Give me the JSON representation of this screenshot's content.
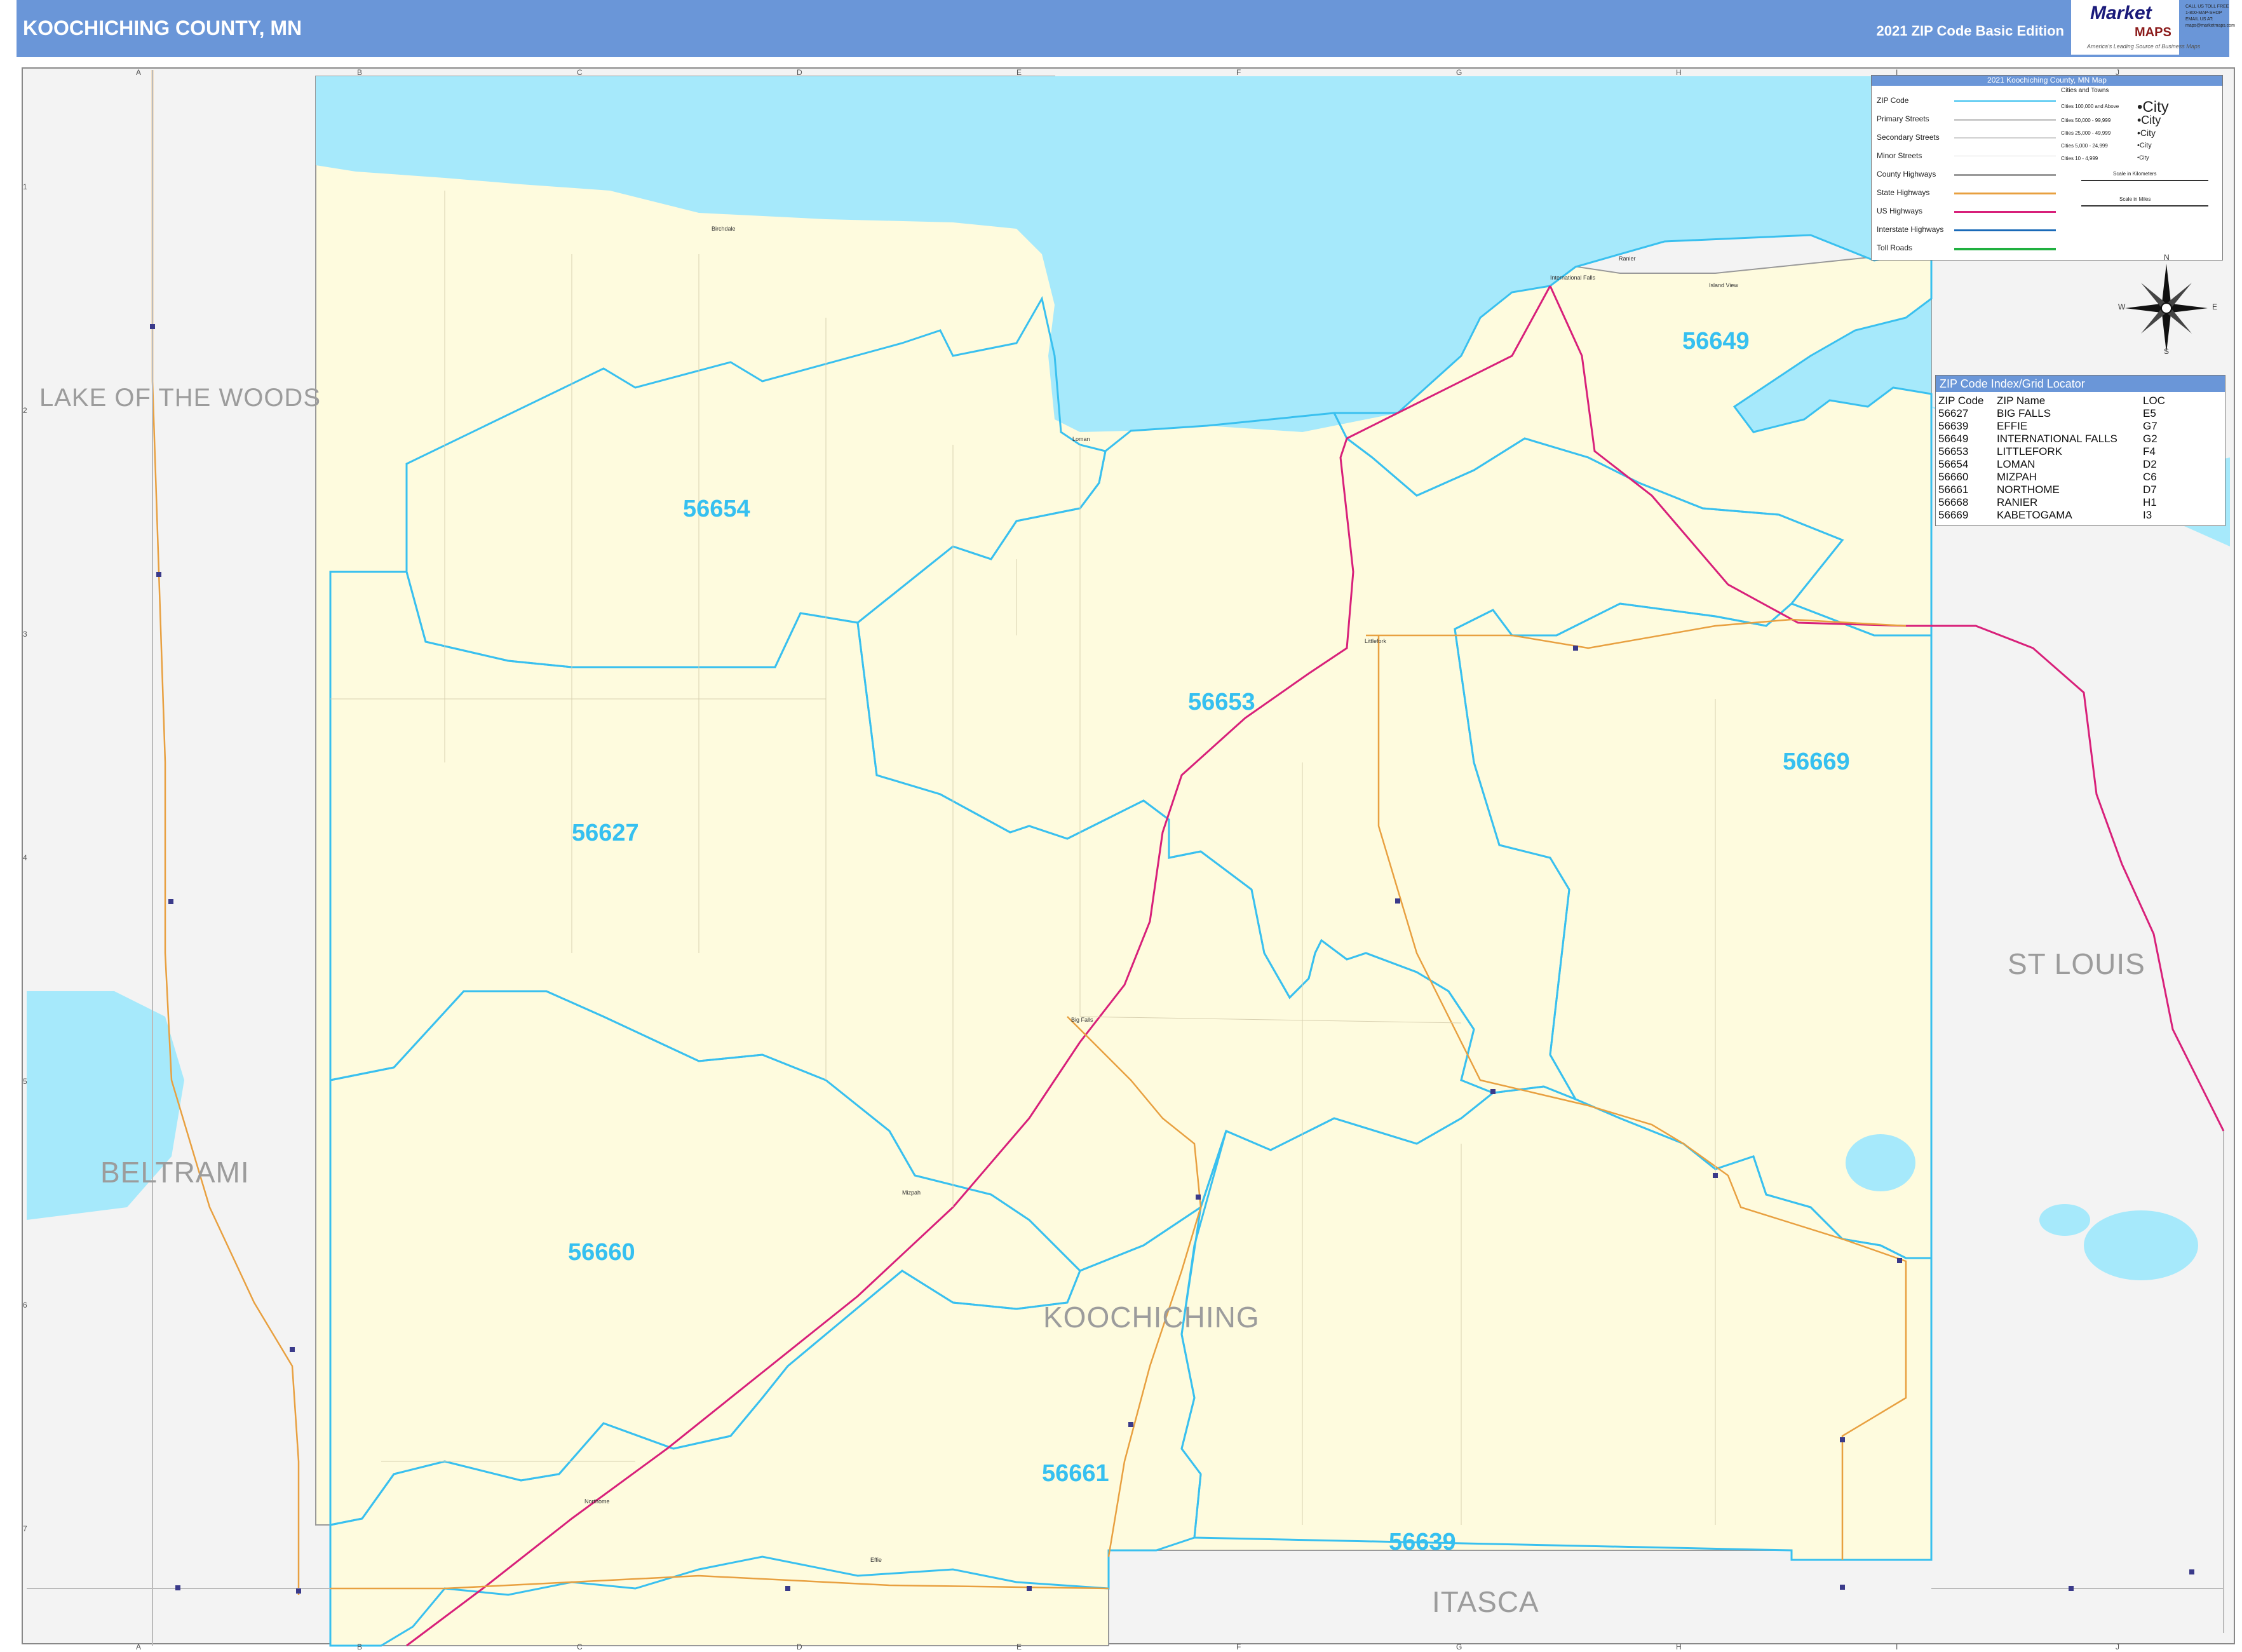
{
  "header": {
    "title": "KOOCHICHING COUNTY, MN",
    "edition": "2021 ZIP Code Basic Edition",
    "logo_brand": "Market",
    "logo_maps": "MAPS",
    "logo_tagline": "America's Leading Source of Business Maps",
    "logo_contact": "CALL US TOLL FREE 1-800-MAP-SHOP EMAIL US AT: maps@marketmaps.com"
  },
  "grid": {
    "columns": [
      "A",
      "B",
      "C",
      "D",
      "E",
      "F",
      "G",
      "H",
      "I",
      "J"
    ],
    "rows": [
      "1",
      "2",
      "3",
      "4",
      "5",
      "6",
      "7"
    ]
  },
  "counties": {
    "lake_of_the_woods": "LAKE OF THE WOODS",
    "beltrami": "BELTRAMI",
    "st_louis": "ST LOUIS",
    "koochiching": "KOOCHICHING",
    "itasca": "ITASCA"
  },
  "zip_labels": {
    "z56654": "56654",
    "z56653": "56653",
    "z56649": "56649",
    "z56627": "56627",
    "z56669": "56669",
    "z56660": "56660",
    "z56661": "56661",
    "z56639": "56639"
  },
  "places": {
    "international_falls": "International Falls",
    "littlefork": "Littlefork",
    "big_falls": "Big Falls",
    "northome": "Northome",
    "mizpah": "Mizpah",
    "loman": "Loman",
    "ranier": "Ranier",
    "birchdale": "Birchdale",
    "island_view": "Island View",
    "effie": "Effie"
  },
  "legend": {
    "title": "2021 Koochiching County, MN Map",
    "items": [
      "ZIP Code",
      "Primary Streets",
      "Secondary Streets",
      "Minor Streets",
      "County Highways",
      "State Highways",
      "US Highways",
      "Interstate Highways",
      "Toll Roads"
    ],
    "cities_title": "Cities and Towns",
    "city_tiers": [
      "Cities 100,000 and Above",
      "Cities 50,000 - 99,999",
      "Cities 25,000 - 49,999",
      "Cities 5,000 - 24,999",
      "Cities 10 - 4,999"
    ],
    "city_samples": [
      "•City",
      "•City",
      "•City",
      "•City",
      "•City"
    ],
    "scale_km": "Scale in Kilometers",
    "scale_mi": "Scale in Miles",
    "colors": {
      "zip": "#39c0ef",
      "primary": "#c8c8c8",
      "county_hwy": "#9a9a9a",
      "state_hwy": "#e8a040",
      "us_hwy": "#d8207a",
      "interstate": "#1a6ab8",
      "toll": "#20b040"
    }
  },
  "compass": {
    "n": "N",
    "s": "S",
    "e": "E",
    "w": "W"
  },
  "zip_index": {
    "title": "ZIP Code Index/Grid Locator",
    "headers": [
      "ZIP Code",
      "ZIP Name",
      "LOC"
    ],
    "rows": [
      [
        "56627",
        "BIG FALLS",
        "E5"
      ],
      [
        "56639",
        "EFFIE",
        "G7"
      ],
      [
        "56649",
        "INTERNATIONAL FALLS",
        "G2"
      ],
      [
        "56653",
        "LITTLEFORK",
        "F4"
      ],
      [
        "56654",
        "LOMAN",
        "D2"
      ],
      [
        "56660",
        "MIZPAH",
        "C6"
      ],
      [
        "56661",
        "NORTHOME",
        "D7"
      ],
      [
        "56668",
        "RANIER",
        "H1"
      ],
      [
        "56669",
        "KABETOGAMA",
        "I3"
      ]
    ]
  },
  "colors": {
    "header": "#6a96d8",
    "water": "#a6e9fb",
    "county_fill": "#fefbde",
    "outside_fill": "#f3f3f3",
    "zip_boundary": "#39c0ef"
  }
}
